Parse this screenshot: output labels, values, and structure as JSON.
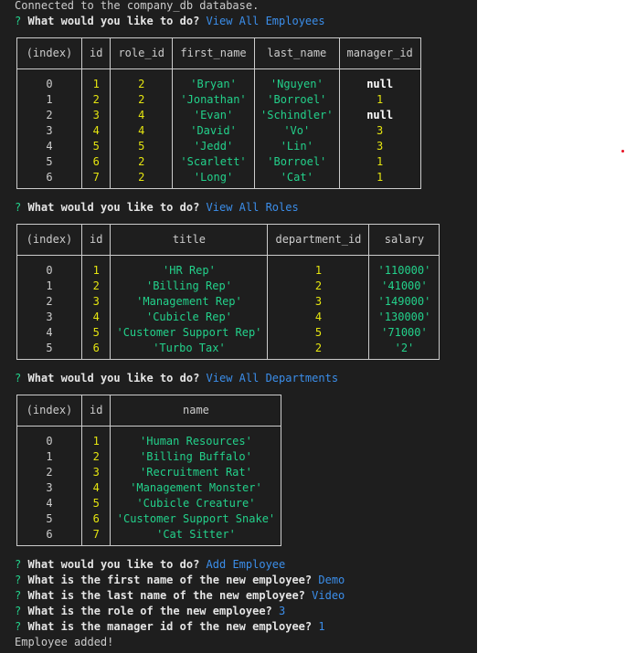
{
  "connected_message": "Connected to the company_db database.",
  "prompt_mark": "?",
  "q_todo": "What would you like to do?",
  "a1": "View All Employees",
  "a2": "View All Roles",
  "a3": "View All Departments",
  "a4": "Add Employee",
  "q_first": "What is the first name of the new employee?",
  "a_first": "Demo",
  "q_last": "What is the last name of the new employee?",
  "a_last": "Video",
  "q_role": "What is the role of the new employee?",
  "a_role": "3",
  "q_manager": "What is the manager id of the new employee?",
  "a_manager": "1",
  "done_message": "Employee added!",
  "employees": {
    "headers": [
      "(index)",
      "id",
      "role_id",
      "first_name",
      "last_name",
      "manager_id"
    ],
    "rows": [
      [
        "0",
        "1",
        "2",
        "'Bryan'",
        "'Nguyen'",
        "null"
      ],
      [
        "1",
        "2",
        "2",
        "'Jonathan'",
        "'Borroel'",
        "1"
      ],
      [
        "2",
        "3",
        "4",
        "'Evan'",
        "'Schindler'",
        "null"
      ],
      [
        "3",
        "4",
        "4",
        "'David'",
        "'Vo'",
        "3"
      ],
      [
        "4",
        "5",
        "5",
        "'Jedd'",
        "'Lin'",
        "3"
      ],
      [
        "5",
        "6",
        "2",
        "'Scarlett'",
        "'Borroel'",
        "1"
      ],
      [
        "6",
        "7",
        "2",
        "'Long'",
        "'Cat'",
        "1"
      ]
    ]
  },
  "roles": {
    "headers": [
      "(index)",
      "id",
      "title",
      "department_id",
      "salary"
    ],
    "rows": [
      [
        "0",
        "1",
        "'HR Rep'",
        "1",
        "'110000'"
      ],
      [
        "1",
        "2",
        "'Billing Rep'",
        "2",
        "'41000'"
      ],
      [
        "2",
        "3",
        "'Management Rep'",
        "3",
        "'149000'"
      ],
      [
        "3",
        "4",
        "'Cubicle Rep'",
        "4",
        "'130000'"
      ],
      [
        "4",
        "5",
        "'Customer Support Rep'",
        "5",
        "'71000'"
      ],
      [
        "5",
        "6",
        "'Turbo Tax'",
        "2",
        "'2'"
      ]
    ]
  },
  "departments": {
    "headers": [
      "(index)",
      "id",
      "name"
    ],
    "rows": [
      [
        "0",
        "1",
        "'Human Resources'"
      ],
      [
        "1",
        "2",
        "'Billing Buffalo'"
      ],
      [
        "2",
        "3",
        "'Recruitment Rat'"
      ],
      [
        "3",
        "4",
        "'Management Monster'"
      ],
      [
        "4",
        "5",
        "'Cubicle Creature'"
      ],
      [
        "5",
        "6",
        "'Customer Support Snake'"
      ],
      [
        "6",
        "7",
        "'Cat Sitter'"
      ]
    ]
  },
  "colors": {
    "background": "#1e1e1e",
    "text": "#cccccc",
    "prompt_mark": "#23d18b",
    "answer": "#3b8eea",
    "number": "#e5e510",
    "string": "#23d18b"
  }
}
